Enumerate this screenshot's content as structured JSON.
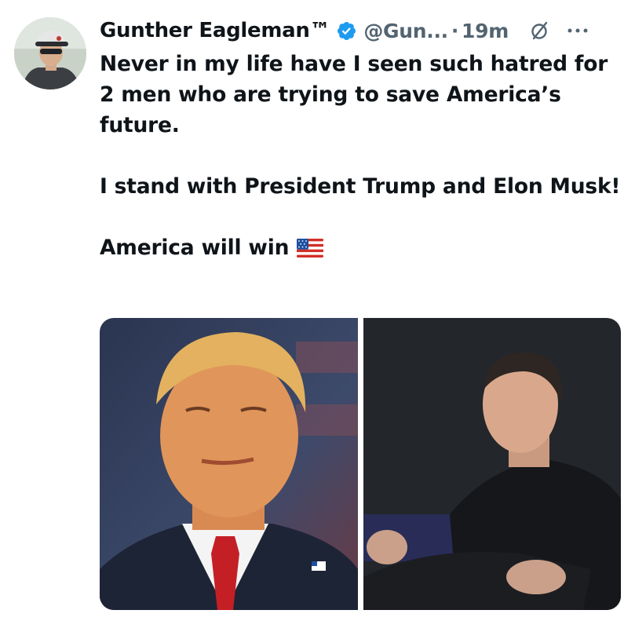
{
  "tweet": {
    "author_name": "Gunther Eagleman™",
    "handle": "@Gun...",
    "separator": "·",
    "time": "19m",
    "paragraphs": [
      "Never in my life have I seen such hatred for 2 men who are trying to save America’s future.",
      "I stand with President Trump and Elon Musk!",
      "America will win"
    ],
    "emoji": "us-flag-emoji"
  },
  "icons": {
    "verified": "verified-badge-icon",
    "grok": "grok-icon",
    "more": "more-options-icon"
  },
  "colors": {
    "text": "#0f1419",
    "secondary": "#536471",
    "verified": "#1d9bf0"
  },
  "media": {
    "images": [
      "photo-left-portrait",
      "photo-right-portrait"
    ]
  }
}
